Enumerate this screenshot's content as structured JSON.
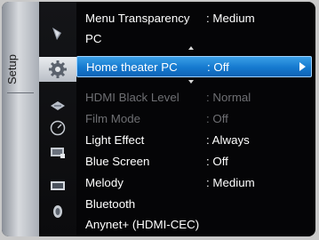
{
  "sidebar": {
    "category_label": "Setup"
  },
  "icons": [
    {
      "name": "picture-icon"
    },
    {
      "name": "setup-gear-icon"
    },
    {
      "name": "input-icon"
    },
    {
      "name": "application-icon"
    },
    {
      "name": "support-icon"
    },
    {
      "name": "multimedia-icon"
    },
    {
      "name": "sound-icon"
    }
  ],
  "menu": {
    "items": [
      {
        "label": "Menu Transparency",
        "value": ": Medium",
        "state": "normal"
      },
      {
        "label": "PC",
        "value": "",
        "state": "normal"
      },
      {
        "label": "Home theater PC",
        "value": ": Off",
        "state": "selected"
      },
      {
        "label": "HDMI Black Level",
        "value": ": Normal",
        "state": "disabled"
      },
      {
        "label": "Film Mode",
        "value": ": Off",
        "state": "disabled"
      },
      {
        "label": "Light Effect",
        "value": ": Always",
        "state": "normal"
      },
      {
        "label": "Blue Screen",
        "value": ": Off",
        "state": "normal"
      },
      {
        "label": "Melody",
        "value": ": Medium",
        "state": "normal"
      },
      {
        "label": "Bluetooth",
        "value": "",
        "state": "normal"
      },
      {
        "label": "Anynet+ (HDMI-CEC)",
        "value": "",
        "state": "normal"
      }
    ]
  },
  "colors": {
    "highlight": "#1b7fd4",
    "background": "#050507",
    "disabled_text": "#6e6f73"
  }
}
